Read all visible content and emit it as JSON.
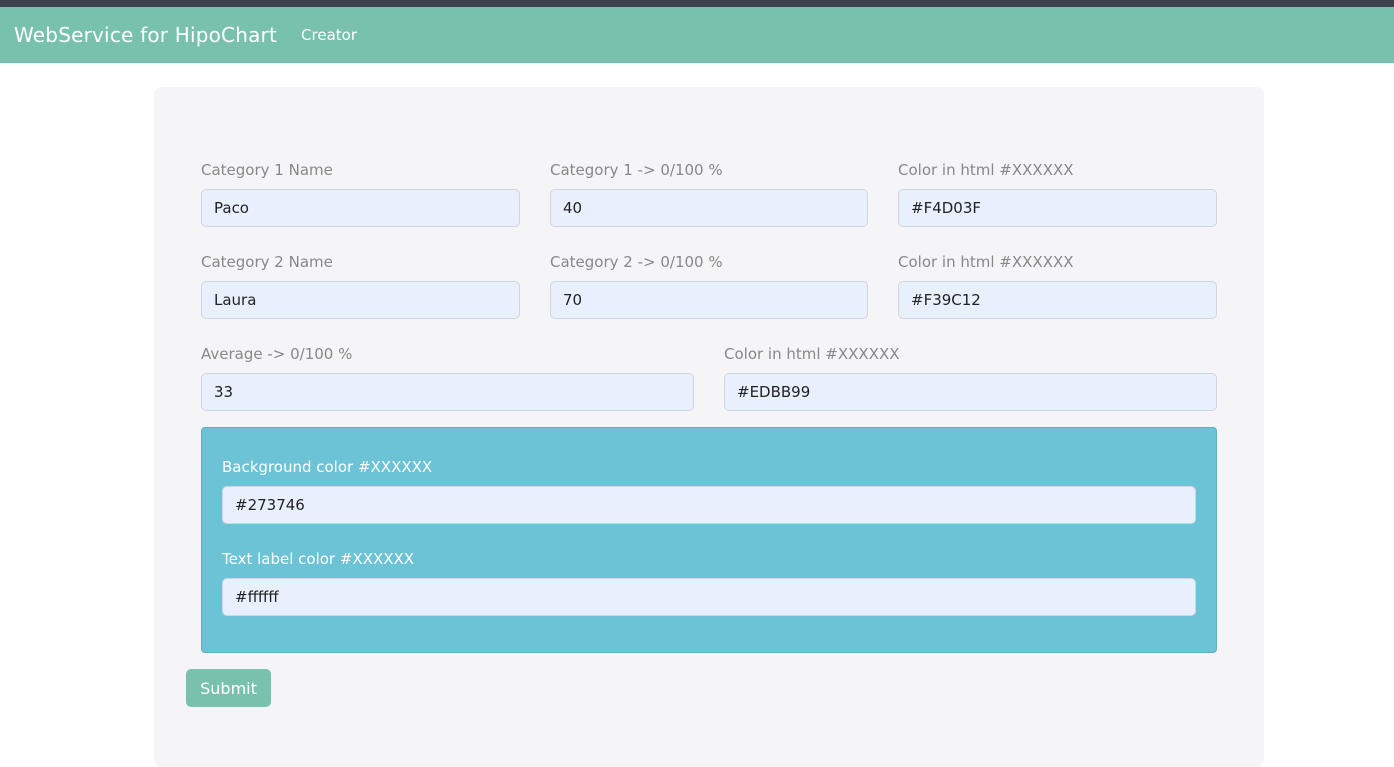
{
  "navbar": {
    "brand": "WebService for HipoChart",
    "link_creator": "Creator"
  },
  "form": {
    "cat1": {
      "name_label": "Category 1 Name",
      "name_value": "Paco",
      "pct_label": "Category 1 -> 0/100 %",
      "pct_value": "40",
      "color_label": "Color in html #XXXXXX",
      "color_value": "#F4D03F"
    },
    "cat2": {
      "name_label": "Category 2 Name",
      "name_value": "Laura",
      "pct_label": "Category 2 -> 0/100 %",
      "pct_value": "70",
      "color_label": "Color in html #XXXXXX",
      "color_value": "#F39C12"
    },
    "average": {
      "label": "Average -> 0/100 %",
      "value": "33",
      "color_label": "Color in html #XXXXXX",
      "color_value": "#EDBB99"
    },
    "background": {
      "label": "Background color #XXXXXX",
      "value": "#273746"
    },
    "text_label": {
      "label": "Text label color #XXXXXX",
      "value": "#ffffff"
    },
    "submit_label": "Submit"
  },
  "colors": {
    "accent": "#78c2ad",
    "info_panel": "#6cc3d5",
    "input_bg": "#e8f0fe",
    "top_strip": "#3c4150"
  }
}
